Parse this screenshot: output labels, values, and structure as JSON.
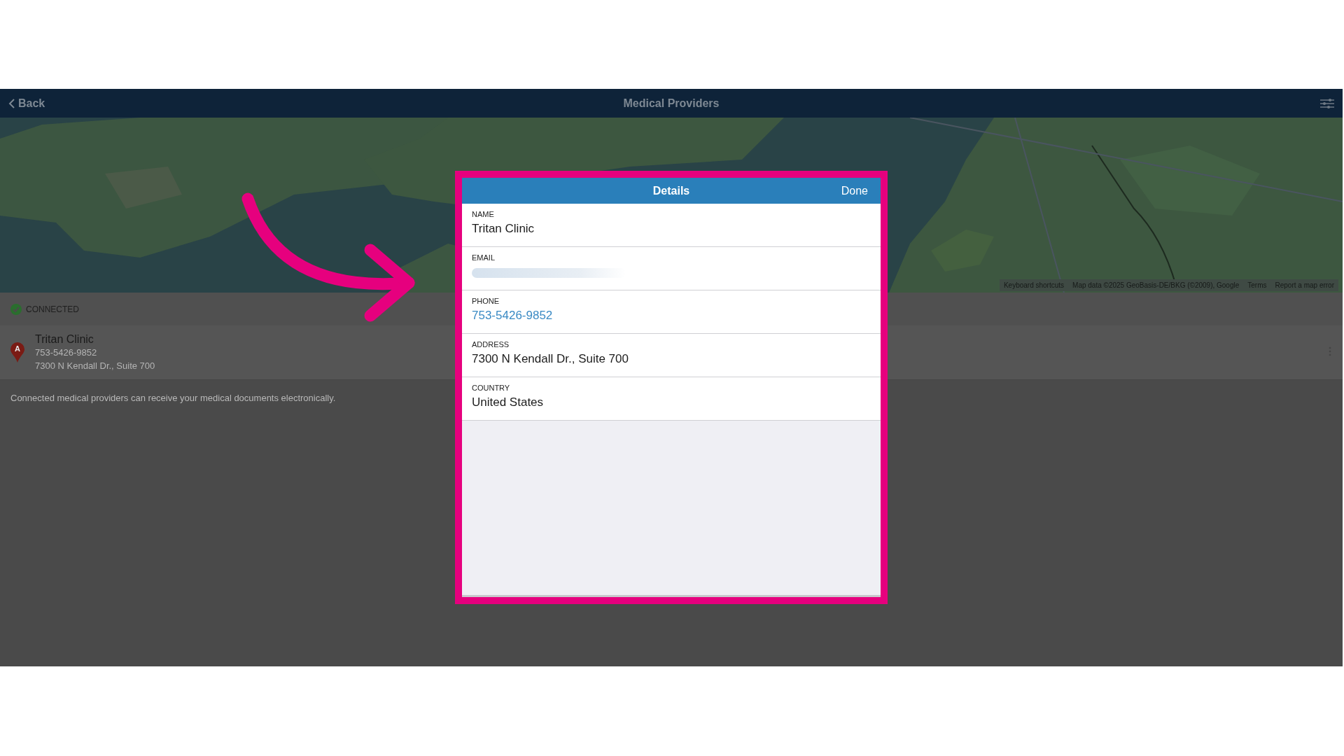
{
  "header": {
    "back": "Back",
    "title": "Medical Providers"
  },
  "map": {
    "kind": "picture",
    "attribution": [
      "Keyboard shortcuts",
      "Map data ©2025 GeoBasis-DE/BKG (©2009), Google",
      "Terms",
      "Report a map error"
    ]
  },
  "section": {
    "label": "CONNECTED",
    "connected": true
  },
  "providers": [
    {
      "marker": "A",
      "name": "Tritan Clinic",
      "phone": "753-5426-9852",
      "address": "7300 N Kendall Dr., Suite 700"
    }
  ],
  "note": "Connected medical providers can receive your medical documents electronically.",
  "dialog": {
    "title": "Details",
    "done": "Done",
    "fields": [
      {
        "label": "NAME",
        "value": "Tritan Clinic",
        "kind": "text"
      },
      {
        "label": "EMAIL",
        "kind": "redacted"
      },
      {
        "label": "PHONE",
        "value": "753-5426-9852",
        "kind": "link"
      },
      {
        "label": "ADDRESS",
        "value": "7300 N Kendall Dr., Suite 700",
        "kind": "text"
      },
      {
        "label": "COUNTRY",
        "value": "United States",
        "kind": "text"
      }
    ]
  }
}
